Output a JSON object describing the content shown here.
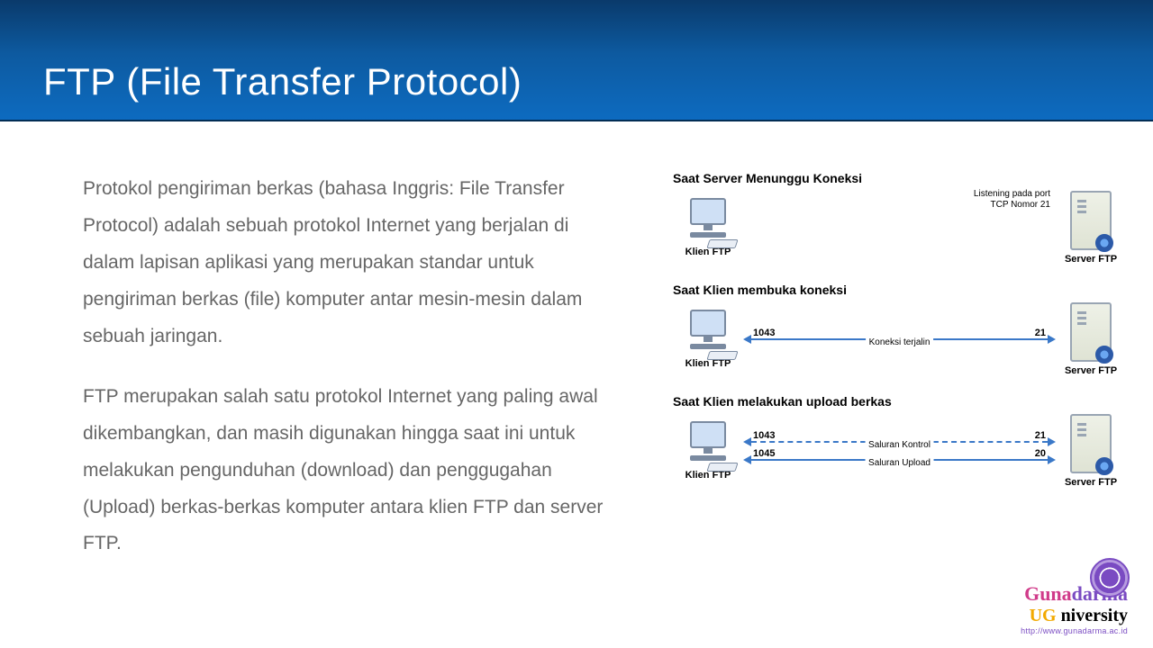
{
  "title": "FTP (File Transfer Protocol)",
  "paragraphs": [
    "Protokol pengiriman berkas (bahasa Inggris: File Transfer Protocol) adalah sebuah protokol Internet yang berjalan di dalam lapisan aplikasi yang merupakan standar untuk pengiriman berkas (file) komputer antar mesin-mesin dalam sebuah jaringan.",
    "FTP merupakan salah satu protokol Internet yang paling awal dikembangkan, dan masih digunakan hingga saat ini untuk melakukan pengunduhan (download) dan penggugahan (Upload) berkas-berkas komputer antara klien FTP dan server FTP."
  ],
  "diagram": {
    "client_label": "Klien FTP",
    "server_label": "Server FTP",
    "scenes": [
      {
        "title": "Saat Server Menunggu Koneksi",
        "note": "Listening pada port\nTCP Nomor 21",
        "lines": []
      },
      {
        "title": "Saat Klien membuka koneksi",
        "note": "",
        "lines": [
          {
            "left_port": "1043",
            "right_port": "21",
            "label": "Koneksi terjalin",
            "style": "solid",
            "double": true
          }
        ]
      },
      {
        "title": "Saat Klien melakukan upload berkas",
        "note": "",
        "lines": [
          {
            "left_port": "1043",
            "right_port": "21",
            "label": "Saluran Kontrol",
            "style": "dashed",
            "double": true
          },
          {
            "left_port": "1045",
            "right_port": "20",
            "label": "Saluran Upload",
            "style": "solid",
            "double": true
          }
        ]
      }
    ]
  },
  "footer": {
    "line1a": "Guna",
    "line1b": "darma",
    "line2a": "U",
    "line2b": "niversity",
    "ug_small": "UG",
    "url": "http://www.gunadarma.ac.id"
  }
}
